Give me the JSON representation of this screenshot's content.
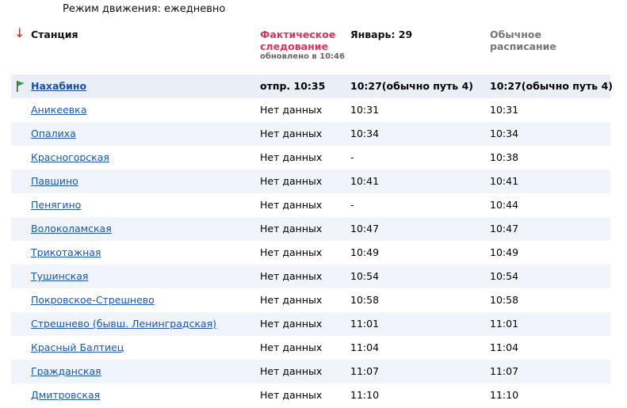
{
  "mode_text": "Режим движения: ежедневно",
  "header": {
    "arrow": "↓",
    "station": "Станция",
    "actual": "Фактическое следование",
    "updated": "обновлено в 10:46",
    "date": "Январь: 29",
    "regular": "Обычное расписание"
  },
  "colors": {
    "link": "#1b56b8",
    "actual_header": "#e2325a",
    "row_alt": "#f1f4fa",
    "flag": "#2e9e3a"
  },
  "rows": [
    {
      "station": "Нахабино",
      "actual": "отпр. 10:35",
      "date": "10:27(обычно путь 4)",
      "regular": "10:27(обычно путь 4)",
      "flag": true
    },
    {
      "station": "Аникеевка",
      "actual": "Нет данных",
      "date": "10:31",
      "regular": "10:31"
    },
    {
      "station": "Опалиха",
      "actual": "Нет данных",
      "date": "10:34",
      "regular": "10:34"
    },
    {
      "station": "Красногорская",
      "actual": "Нет данных",
      "date": "-",
      "regular": "10:38"
    },
    {
      "station": "Павшино",
      "actual": "Нет данных",
      "date": "10:41",
      "regular": "10:41"
    },
    {
      "station": "Пенягино",
      "actual": "Нет данных",
      "date": "-",
      "regular": "10:44"
    },
    {
      "station": "Волоколамская",
      "actual": "Нет данных",
      "date": "10:47",
      "regular": "10:47"
    },
    {
      "station": "Трикотажная",
      "actual": "Нет данных",
      "date": "10:49",
      "regular": "10:49"
    },
    {
      "station": "Тушинская",
      "actual": "Нет данных",
      "date": "10:54",
      "regular": "10:54"
    },
    {
      "station": "Покровское-Стрешнево",
      "actual": "Нет данных",
      "date": "10:58",
      "regular": "10:58"
    },
    {
      "station": "Стрешнево (бывш. Ленинградская)",
      "actual": "Нет данных",
      "date": "11:01",
      "regular": "11:01"
    },
    {
      "station": "Красный Балтиец",
      "actual": "Нет данных",
      "date": "11:04",
      "regular": "11:04"
    },
    {
      "station": "Гражданская",
      "actual": "Нет данных",
      "date": "11:07",
      "regular": "11:07"
    },
    {
      "station": "Дмитровская",
      "actual": "Нет данных",
      "date": "11:10",
      "regular": "11:10"
    }
  ]
}
